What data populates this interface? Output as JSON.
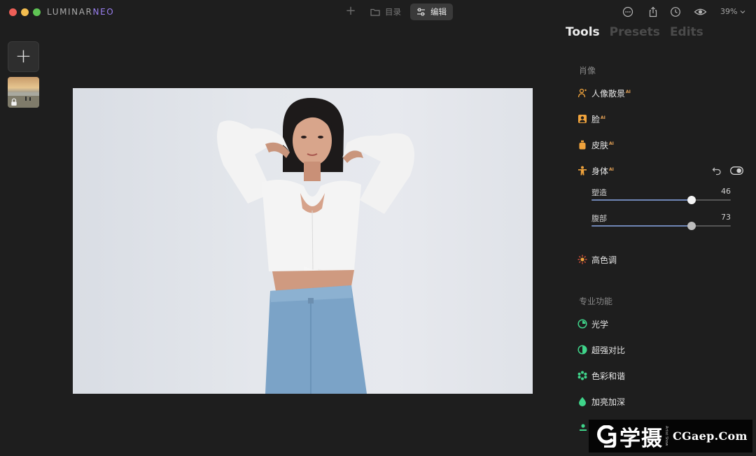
{
  "app": {
    "logo_prefix": "LUMINAR",
    "logo_suffix": "NEO"
  },
  "toolbar": {
    "catalog_label": "目录",
    "edit_label": "编辑",
    "zoom_level": "39%"
  },
  "panel": {
    "tabs": [
      {
        "label": "Tools",
        "active": true
      },
      {
        "label": "Presets",
        "active": false
      },
      {
        "label": "Edits",
        "active": false
      }
    ],
    "sections": {
      "portrait": "肖像",
      "professional": "专业功能"
    },
    "tools": {
      "bokeh": {
        "label": "人像散景",
        "ai": "AI",
        "icon": "portrait-bokeh-icon"
      },
      "face": {
        "label": "脸",
        "ai": "AI",
        "icon": "face-icon"
      },
      "skin": {
        "label": "皮肤",
        "ai": "AI",
        "icon": "skin-icon"
      },
      "body": {
        "label": "身体",
        "ai": "AI",
        "icon": "body-icon"
      },
      "highkey": {
        "label": "高色调",
        "icon": "high-key-icon"
      },
      "light": {
        "label": "光学",
        "icon": "optics-icon"
      },
      "contrast": {
        "label": "超强对比",
        "icon": "supercontrast-icon"
      },
      "harmony": {
        "label": "色彩和谐",
        "icon": "color-harmony-icon"
      },
      "dodge": {
        "label": "加亮加深",
        "icon": "dodge-burn-icon"
      }
    },
    "sliders": [
      {
        "label": "塑造",
        "value": "46",
        "fraction": 0.72
      },
      {
        "label": "腹部",
        "value": "73",
        "fraction": 0.72
      }
    ]
  },
  "watermark": {
    "cn": "学摄",
    "small": "Artist Show",
    "en": "CGaep.Com"
  },
  "colors": {
    "accent_blue": "#6f86b6",
    "ai_orange": "#e6a255",
    "portrait_orange": "#f0a33c",
    "pro_green": "#3fd48a"
  }
}
